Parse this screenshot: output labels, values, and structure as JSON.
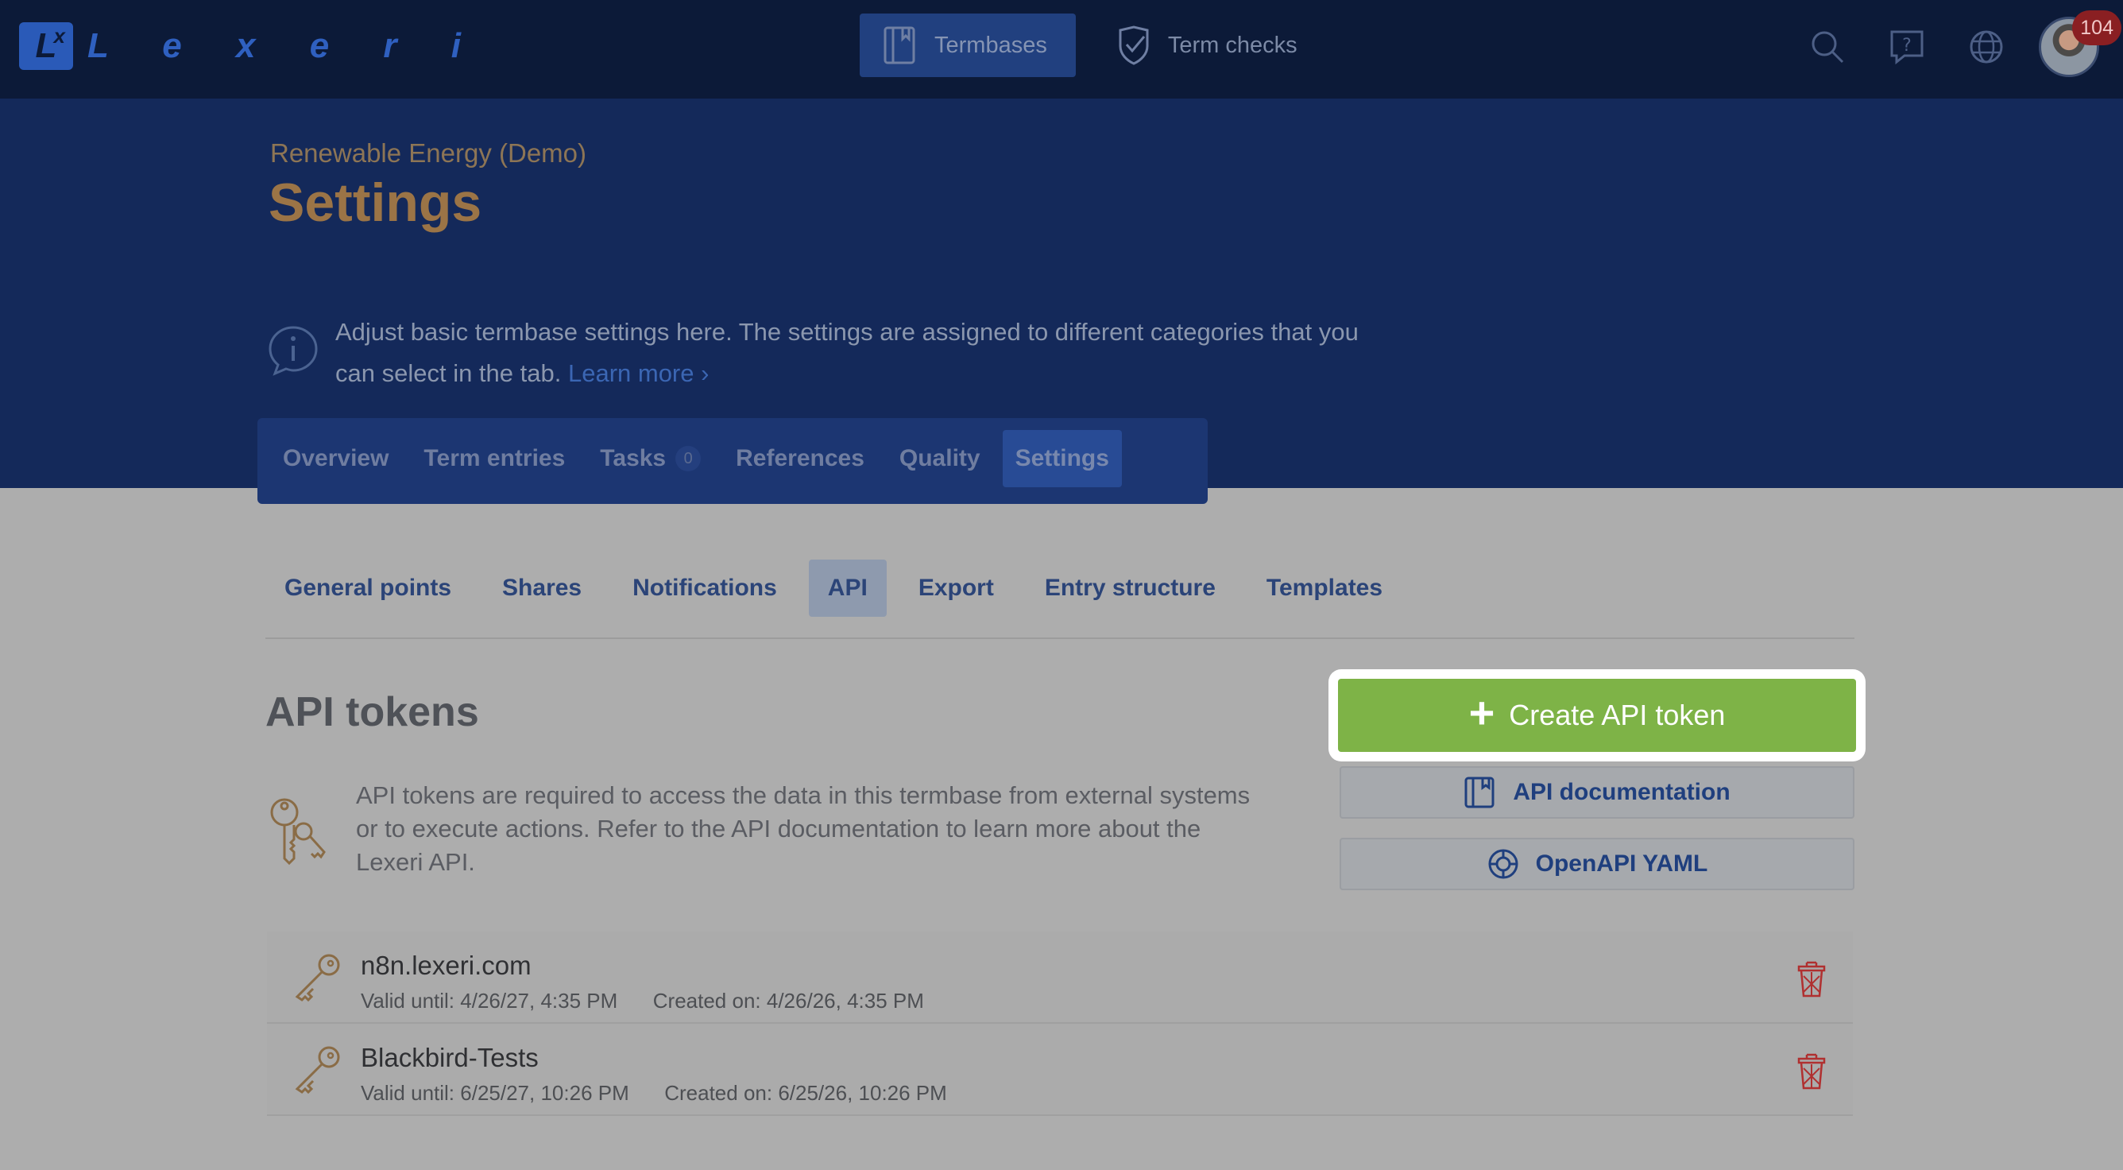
{
  "app": {
    "logo_letter": "L",
    "logo_sup": "x",
    "logo_name": "L e x e r i"
  },
  "topnav": [
    {
      "label": "Termbases",
      "icon": "book-icon",
      "active": true
    },
    {
      "label": "Term checks",
      "icon": "shield-check-icon",
      "active": false
    }
  ],
  "top_icons": [
    "search-icon",
    "help-icon",
    "globe-icon"
  ],
  "user": {
    "notification_count": "104"
  },
  "header": {
    "breadcrumb": "Renewable Energy (Demo)",
    "title": "Settings",
    "info_text": "Adjust basic termbase settings here. The settings are assigned to different categories that you can select in the tab.",
    "learn_more": "Learn more"
  },
  "main_tabs": [
    {
      "label": "Overview",
      "active": false
    },
    {
      "label": "Term entries",
      "active": false
    },
    {
      "label": "Tasks",
      "count": "0",
      "active": false
    },
    {
      "label": "References",
      "active": false
    },
    {
      "label": "Quality",
      "active": false
    },
    {
      "label": "Settings",
      "active": true
    }
  ],
  "sub_tabs": [
    {
      "label": "General points",
      "active": false
    },
    {
      "label": "Shares",
      "active": false
    },
    {
      "label": "Notifications",
      "active": false
    },
    {
      "label": "API",
      "active": true
    },
    {
      "label": "Export",
      "active": false
    },
    {
      "label": "Entry structure",
      "active": false
    },
    {
      "label": "Templates",
      "active": false
    }
  ],
  "api": {
    "title": "API tokens",
    "description": "API tokens are required to access the data in this termbase from external systems or to execute actions. Refer to the API documentation to learn more about the Lexeri API.",
    "create_label": "Create API token",
    "docs_label": "API documentation",
    "yaml_label": "OpenAPI YAML",
    "colors": {
      "create": "#7eb347",
      "accent": "#1f3f7e",
      "delete": "#b03030"
    }
  },
  "tokens": [
    {
      "name": "n8n.lexeri.com",
      "valid_label": "Valid until:",
      "valid_until": "4/26/27, 4:35 PM",
      "created_label": "Created on:",
      "created_on": "4/26/26, 4:35 PM"
    },
    {
      "name": "Blackbird-Tests",
      "valid_label": "Valid until:",
      "valid_until": "6/25/27, 10:26 PM",
      "created_label": "Created on:",
      "created_on": "6/25/26, 10:26 PM"
    }
  ]
}
